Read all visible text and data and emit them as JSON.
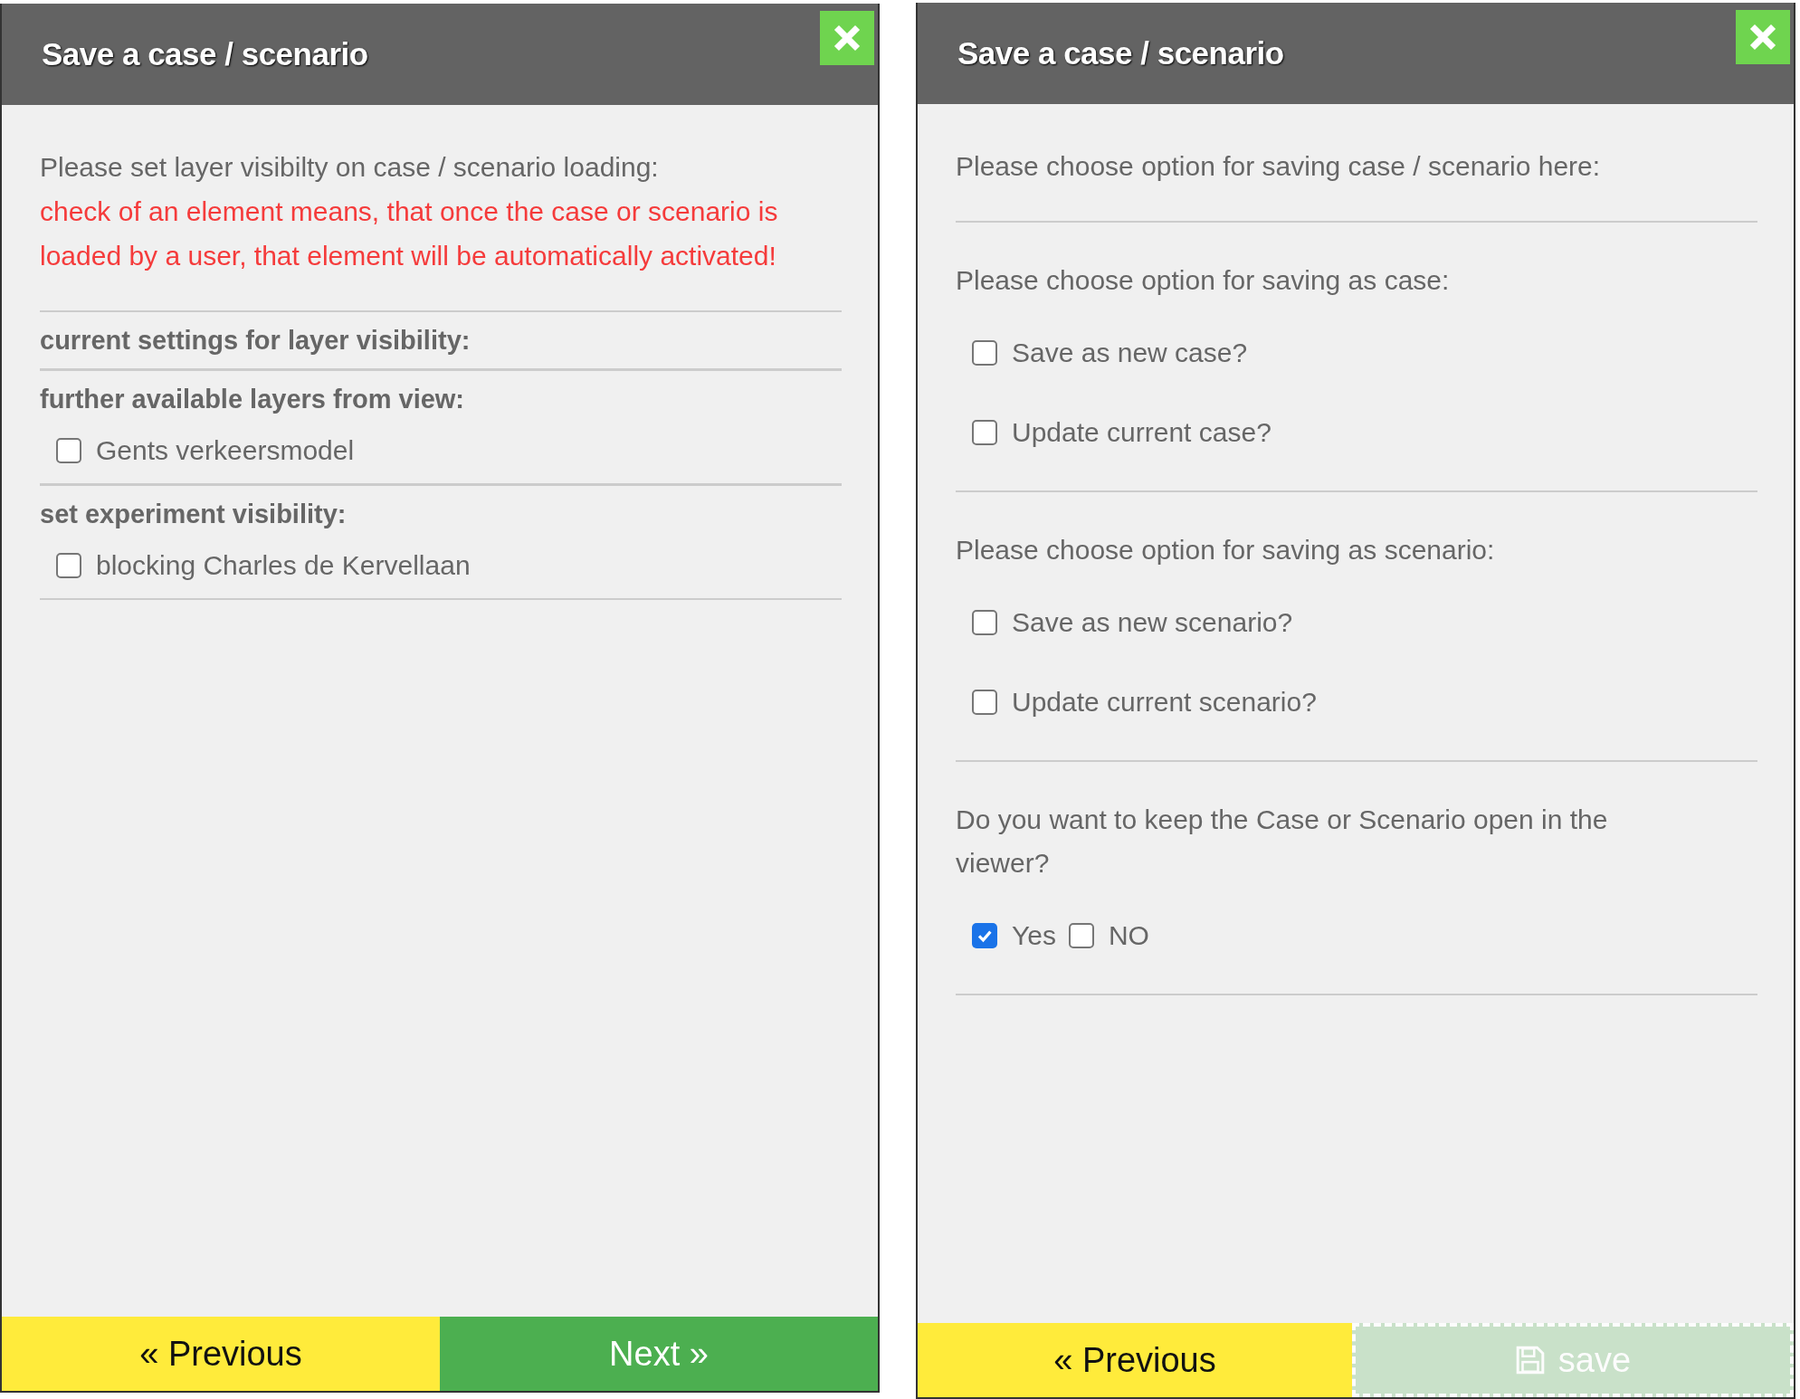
{
  "panels": [
    {
      "title": "Save a case / scenario",
      "intro": "Please set layer visibilty on case / scenario loading:",
      "note": "check of an element means, that once the case or scenario is loaded by a user, that element will be automatically activated!",
      "sections": [
        {
          "kind": "heading",
          "text": "current settings for layer visibility:"
        },
        {
          "kind": "heading",
          "text": "further available layers from view:",
          "options": [
            {
              "label": "Gents verkeersmodel",
              "checked": false
            }
          ]
        },
        {
          "kind": "heading",
          "text": "set experiment visibility:",
          "options": [
            {
              "label": "blocking Charles de Kervellaan",
              "checked": false
            }
          ]
        }
      ],
      "buttons": [
        {
          "kind": "previous",
          "label": "« Previous",
          "disabled": false
        },
        {
          "kind": "next",
          "label": "Next »",
          "disabled": false
        }
      ]
    },
    {
      "title": "Save a case / scenario",
      "intro": "Please choose option for saving case / scenario here:",
      "sections": [
        {
          "kind": "prompt",
          "text": "Please choose option for saving as case:",
          "options": [
            {
              "label": "Save as new case?",
              "checked": false
            },
            {
              "label": "Update current case?",
              "checked": false
            }
          ]
        },
        {
          "kind": "prompt",
          "text": "Please choose option for saving as scenario:",
          "options": [
            {
              "label": "Save as new scenario?",
              "checked": false
            },
            {
              "label": "Update current scenario?",
              "checked": false
            }
          ]
        },
        {
          "kind": "inline_prompt",
          "text": "Do you want to keep the Case or Scenario open in the viewer?",
          "options": [
            {
              "label": "Yes",
              "checked": true
            },
            {
              "label": "NO",
              "checked": false
            }
          ]
        }
      ],
      "buttons": [
        {
          "kind": "previous",
          "label": "« Previous",
          "disabled": false
        },
        {
          "kind": "save",
          "label": "save",
          "disabled": true
        }
      ]
    }
  ]
}
